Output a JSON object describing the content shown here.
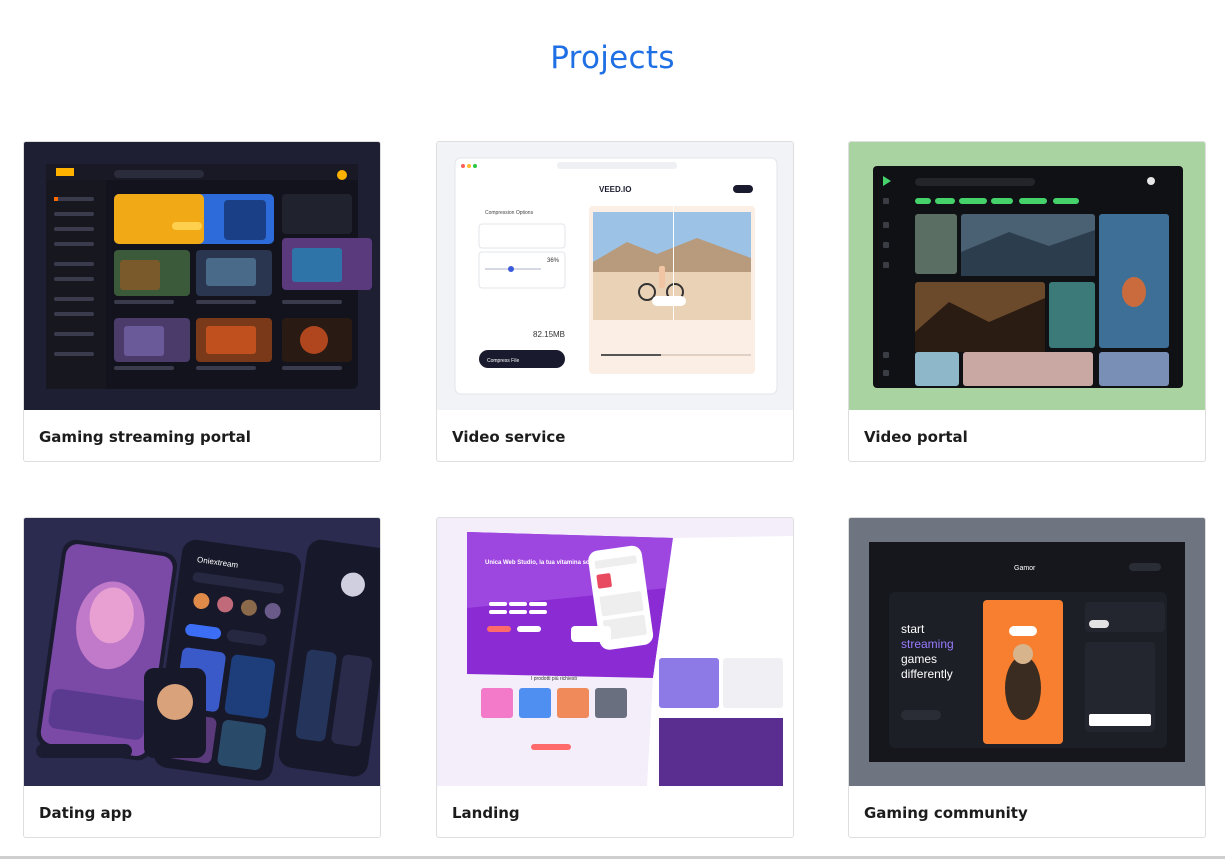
{
  "page": {
    "title": "Projects"
  },
  "projects": [
    {
      "label": "Gaming streaming portal",
      "bg": "#1e1f33"
    },
    {
      "label": "Video service",
      "bg": "#f2f3f6",
      "thumb_text": {
        "brand": "VEED.IO",
        "options": "Compression Options",
        "compression": "36%",
        "size": "82.15MB",
        "button": "Compress File"
      }
    },
    {
      "label": "Video portal",
      "bg": "#a9d3a0"
    },
    {
      "label": "Dating app",
      "bg": "#2a2b4f",
      "thumb_text": {
        "app": "Oniextream"
      }
    },
    {
      "label": "Landing",
      "bg": "#f4eefb",
      "thumb_text": {
        "headline": "Unica Web Studio, la tua vitamina social!",
        "section": "I prodotti più richiesti"
      }
    },
    {
      "label": "Gaming community",
      "bg": "#6e7480",
      "thumb_text": {
        "brand": "Gamor",
        "h1": "start",
        "h2": "streaming",
        "h3": "games",
        "h4": "differently"
      }
    }
  ]
}
